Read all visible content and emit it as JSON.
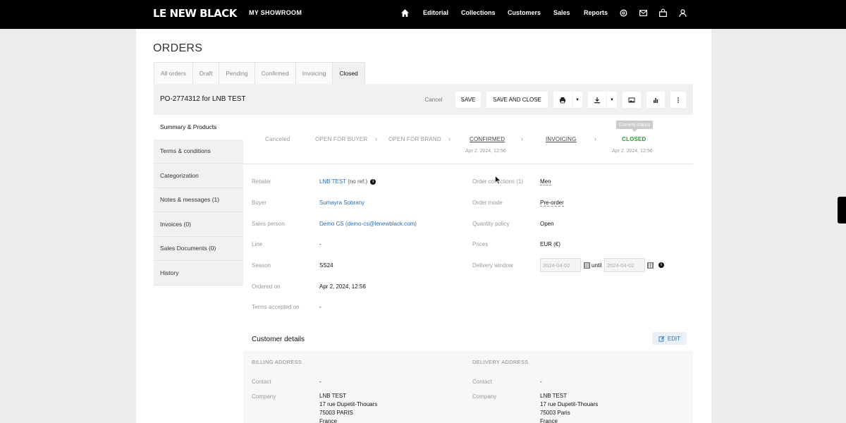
{
  "nav": {
    "logo": "LE NEW BLACK",
    "showroom": "MY SHOWROOM",
    "links": [
      "Editorial",
      "Collections",
      "Customers",
      "Sales",
      "Reports"
    ]
  },
  "page": {
    "title": "ORDERS"
  },
  "tabs": [
    "All orders",
    "Draft",
    "Pending",
    "Confirmed",
    "Invoicing",
    "Closed"
  ],
  "order": {
    "title": "PO-2774312 for LNB TEST",
    "cancel_label": "Cancel",
    "save_label": "SAVE",
    "save_close_label": "SAVE AND CLOSE"
  },
  "menu": [
    "Summary & Products",
    "Terms & conditions",
    "Categorization",
    "Notes & messages (1)",
    "Invoices (0)",
    "Sales Documents (0)",
    "History"
  ],
  "steps": {
    "tooltip": "Current status",
    "items": [
      {
        "label": "Canceled",
        "date": ""
      },
      {
        "label": "OPEN FOR BUYER",
        "date": ""
      },
      {
        "label": "OPEN FOR BRAND",
        "date": ""
      },
      {
        "label": "CONFIRMED",
        "date": "Apr 2, 2024, 12:56"
      },
      {
        "label": "INVOICING",
        "date": ""
      },
      {
        "label": "CLOSED",
        "date": "Apr 2, 2024, 12:56"
      }
    ]
  },
  "details_left": {
    "retailer_label": "Retailer",
    "retailer_value": "LNB TEST",
    "retailer_suffix": "(no ref.)",
    "buyer_label": "Buyer",
    "buyer_value": "Sumayra Sobrany",
    "sales_label": "Sales person",
    "sales_value": "Demo CS (demo-cs@lenewblack.com)",
    "line_label": "Line",
    "line_value": "-",
    "season_label": "Season",
    "season_value": "SS24",
    "ordered_label": "Ordered on",
    "ordered_value": "Apr 2, 2024, 12:56",
    "terms_label": "Terms accepted on",
    "terms_value": "-"
  },
  "details_right": {
    "collections_label": "Order collections (1)",
    "collections_value": "Men",
    "mode_label": "Order mode",
    "mode_value": "Pre-order",
    "quantity_label": "Quantity policy",
    "quantity_value": "Open",
    "prices_label": "Prices",
    "prices_value": "EUR (€)",
    "delivery_label": "Delivery window",
    "delivery_from": "2024-04-02",
    "delivery_until_label": "until",
    "delivery_to": "2024-04-02"
  },
  "customer": {
    "title": "Customer details",
    "edit_label": "EDIT",
    "billing": {
      "heading": "BILLING ADDRESS",
      "contact_label": "Contact",
      "contact_value": "-",
      "company_label": "Company",
      "lines": [
        "LNB TEST",
        "17 rue Dupetit-Thouars",
        "75003 PARIS",
        "France"
      ]
    },
    "delivery": {
      "heading": "DELIVERY ADDRESS",
      "contact_label": "Contact",
      "contact_value": "-",
      "company_label": "Company",
      "lines": [
        "LNB TEST",
        "17 rue Dupetit-Thouars",
        "75003 Paris",
        "France"
      ]
    }
  },
  "colors": {
    "accent_link": "#2a6db5",
    "closed_green": "#2e9a3a",
    "nav_bg": "#000000"
  }
}
